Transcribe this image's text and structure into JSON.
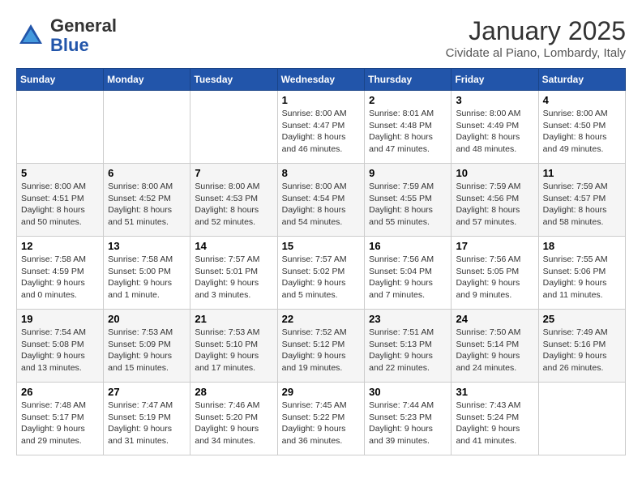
{
  "header": {
    "logo_line1": "General",
    "logo_line2": "Blue",
    "month": "January 2025",
    "location": "Cividate al Piano, Lombardy, Italy"
  },
  "weekdays": [
    "Sunday",
    "Monday",
    "Tuesday",
    "Wednesday",
    "Thursday",
    "Friday",
    "Saturday"
  ],
  "weeks": [
    [
      {
        "day": "",
        "info": ""
      },
      {
        "day": "",
        "info": ""
      },
      {
        "day": "",
        "info": ""
      },
      {
        "day": "1",
        "info": "Sunrise: 8:00 AM\nSunset: 4:47 PM\nDaylight: 8 hours\nand 46 minutes."
      },
      {
        "day": "2",
        "info": "Sunrise: 8:01 AM\nSunset: 4:48 PM\nDaylight: 8 hours\nand 47 minutes."
      },
      {
        "day": "3",
        "info": "Sunrise: 8:00 AM\nSunset: 4:49 PM\nDaylight: 8 hours\nand 48 minutes."
      },
      {
        "day": "4",
        "info": "Sunrise: 8:00 AM\nSunset: 4:50 PM\nDaylight: 8 hours\nand 49 minutes."
      }
    ],
    [
      {
        "day": "5",
        "info": "Sunrise: 8:00 AM\nSunset: 4:51 PM\nDaylight: 8 hours\nand 50 minutes."
      },
      {
        "day": "6",
        "info": "Sunrise: 8:00 AM\nSunset: 4:52 PM\nDaylight: 8 hours\nand 51 minutes."
      },
      {
        "day": "7",
        "info": "Sunrise: 8:00 AM\nSunset: 4:53 PM\nDaylight: 8 hours\nand 52 minutes."
      },
      {
        "day": "8",
        "info": "Sunrise: 8:00 AM\nSunset: 4:54 PM\nDaylight: 8 hours\nand 54 minutes."
      },
      {
        "day": "9",
        "info": "Sunrise: 7:59 AM\nSunset: 4:55 PM\nDaylight: 8 hours\nand 55 minutes."
      },
      {
        "day": "10",
        "info": "Sunrise: 7:59 AM\nSunset: 4:56 PM\nDaylight: 8 hours\nand 57 minutes."
      },
      {
        "day": "11",
        "info": "Sunrise: 7:59 AM\nSunset: 4:57 PM\nDaylight: 8 hours\nand 58 minutes."
      }
    ],
    [
      {
        "day": "12",
        "info": "Sunrise: 7:58 AM\nSunset: 4:59 PM\nDaylight: 9 hours\nand 0 minutes."
      },
      {
        "day": "13",
        "info": "Sunrise: 7:58 AM\nSunset: 5:00 PM\nDaylight: 9 hours\nand 1 minute."
      },
      {
        "day": "14",
        "info": "Sunrise: 7:57 AM\nSunset: 5:01 PM\nDaylight: 9 hours\nand 3 minutes."
      },
      {
        "day": "15",
        "info": "Sunrise: 7:57 AM\nSunset: 5:02 PM\nDaylight: 9 hours\nand 5 minutes."
      },
      {
        "day": "16",
        "info": "Sunrise: 7:56 AM\nSunset: 5:04 PM\nDaylight: 9 hours\nand 7 minutes."
      },
      {
        "day": "17",
        "info": "Sunrise: 7:56 AM\nSunset: 5:05 PM\nDaylight: 9 hours\nand 9 minutes."
      },
      {
        "day": "18",
        "info": "Sunrise: 7:55 AM\nSunset: 5:06 PM\nDaylight: 9 hours\nand 11 minutes."
      }
    ],
    [
      {
        "day": "19",
        "info": "Sunrise: 7:54 AM\nSunset: 5:08 PM\nDaylight: 9 hours\nand 13 minutes."
      },
      {
        "day": "20",
        "info": "Sunrise: 7:53 AM\nSunset: 5:09 PM\nDaylight: 9 hours\nand 15 minutes."
      },
      {
        "day": "21",
        "info": "Sunrise: 7:53 AM\nSunset: 5:10 PM\nDaylight: 9 hours\nand 17 minutes."
      },
      {
        "day": "22",
        "info": "Sunrise: 7:52 AM\nSunset: 5:12 PM\nDaylight: 9 hours\nand 19 minutes."
      },
      {
        "day": "23",
        "info": "Sunrise: 7:51 AM\nSunset: 5:13 PM\nDaylight: 9 hours\nand 22 minutes."
      },
      {
        "day": "24",
        "info": "Sunrise: 7:50 AM\nSunset: 5:14 PM\nDaylight: 9 hours\nand 24 minutes."
      },
      {
        "day": "25",
        "info": "Sunrise: 7:49 AM\nSunset: 5:16 PM\nDaylight: 9 hours\nand 26 minutes."
      }
    ],
    [
      {
        "day": "26",
        "info": "Sunrise: 7:48 AM\nSunset: 5:17 PM\nDaylight: 9 hours\nand 29 minutes."
      },
      {
        "day": "27",
        "info": "Sunrise: 7:47 AM\nSunset: 5:19 PM\nDaylight: 9 hours\nand 31 minutes."
      },
      {
        "day": "28",
        "info": "Sunrise: 7:46 AM\nSunset: 5:20 PM\nDaylight: 9 hours\nand 34 minutes."
      },
      {
        "day": "29",
        "info": "Sunrise: 7:45 AM\nSunset: 5:22 PM\nDaylight: 9 hours\nand 36 minutes."
      },
      {
        "day": "30",
        "info": "Sunrise: 7:44 AM\nSunset: 5:23 PM\nDaylight: 9 hours\nand 39 minutes."
      },
      {
        "day": "31",
        "info": "Sunrise: 7:43 AM\nSunset: 5:24 PM\nDaylight: 9 hours\nand 41 minutes."
      },
      {
        "day": "",
        "info": ""
      }
    ]
  ]
}
